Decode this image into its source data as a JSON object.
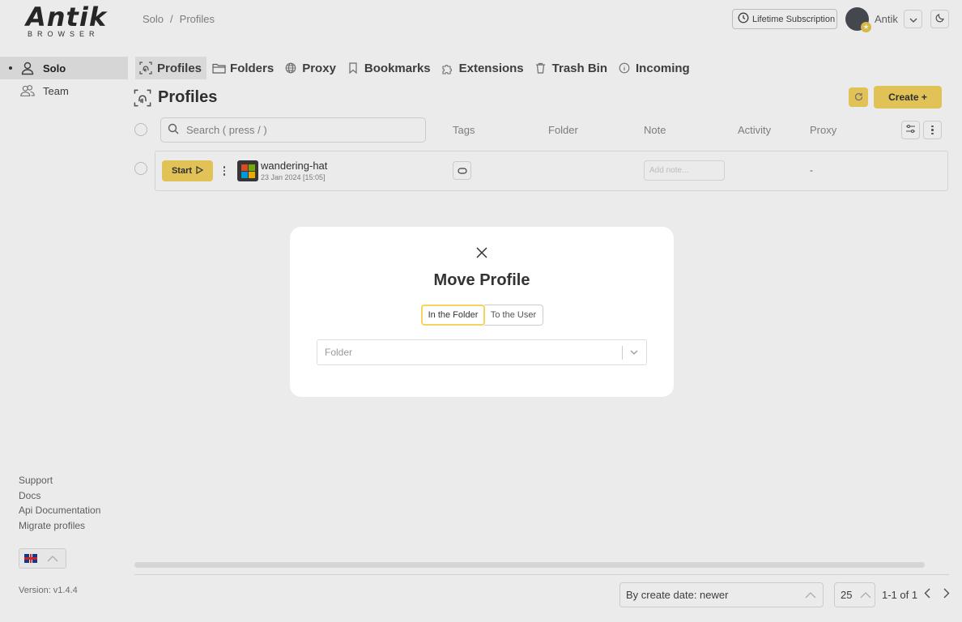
{
  "logo": {
    "word": "Antik",
    "sub": "BROWSER"
  },
  "breadcrumb": [
    "Solo",
    "Profiles"
  ],
  "header": {
    "subscription": "Lifetime Subscription",
    "username": "Antik"
  },
  "sidebar": {
    "items": [
      {
        "label": "Solo",
        "icon": "user-icon",
        "active": true
      },
      {
        "label": "Team",
        "icon": "users-icon",
        "active": false
      }
    ],
    "links": [
      "Support",
      "Docs",
      "Api Documentation",
      "Migrate profiles"
    ],
    "language_flag": "uk-flag-icon",
    "version": "Version: v1.4.4"
  },
  "tabs": [
    {
      "label": "Profiles",
      "icon": "fingerprint-icon",
      "active": true
    },
    {
      "label": "Folders",
      "icon": "folder-icon"
    },
    {
      "label": "Proxy",
      "icon": "globe-icon"
    },
    {
      "label": "Bookmarks",
      "icon": "bookmark-icon"
    },
    {
      "label": "Extensions",
      "icon": "puzzle-icon"
    },
    {
      "label": "Trash Bin",
      "icon": "trash-icon"
    },
    {
      "label": "Incoming",
      "icon": "info-icon"
    }
  ],
  "main": {
    "title": "Profiles",
    "create_label": "Create +",
    "search_placeholder": "Search ( press / )",
    "columns": [
      "Tags",
      "Folder",
      "Note",
      "Activity",
      "Proxy"
    ],
    "rows": [
      {
        "start_label": "Start",
        "name": "wandering-hat",
        "date": "23 Jan 2024 [15:05]",
        "os": "windows-icon",
        "note_placeholder": "Add note...",
        "proxy": "-"
      }
    ]
  },
  "footer": {
    "sort": "By create date: newer",
    "per_page": "25",
    "page_info": "1-1 of 1"
  },
  "modal": {
    "title": "Move Profile",
    "options": [
      "In the Folder",
      "To the User"
    ],
    "selected_option": "In the Folder",
    "folder_placeholder": "Folder"
  },
  "colors": {
    "accent": "#f4d35e",
    "active_bg": "#ececec"
  }
}
